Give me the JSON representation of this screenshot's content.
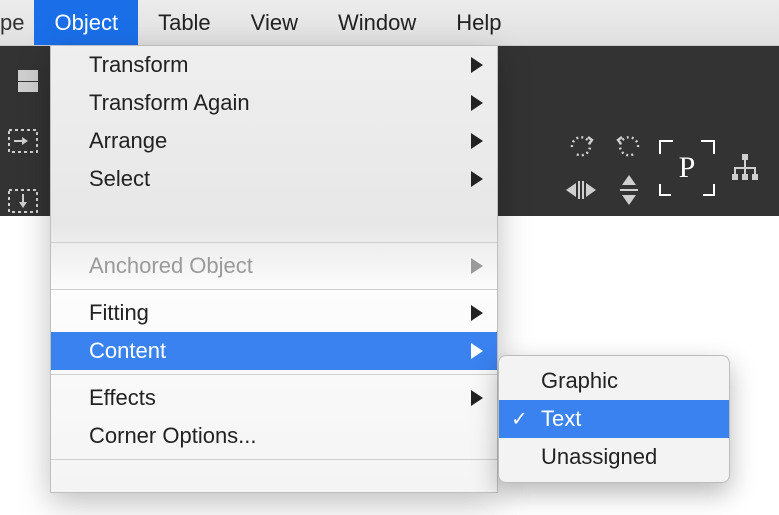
{
  "menubar": {
    "fragment": "pe",
    "items": [
      "Object",
      "Table",
      "View",
      "Window",
      "Help"
    ],
    "activeIndex": 0
  },
  "dropdown": {
    "transform": "Transform",
    "transform_again": "Transform Again",
    "arrange": "Arrange",
    "select": "Select",
    "anchored": "Anchored Object",
    "fitting": "Fitting",
    "content": "Content",
    "effects": "Effects",
    "corner": "Corner Options..."
  },
  "submenu": {
    "graphic": "Graphic",
    "text": "Text",
    "unassigned": "Unassigned",
    "checkedIndex": 1
  }
}
